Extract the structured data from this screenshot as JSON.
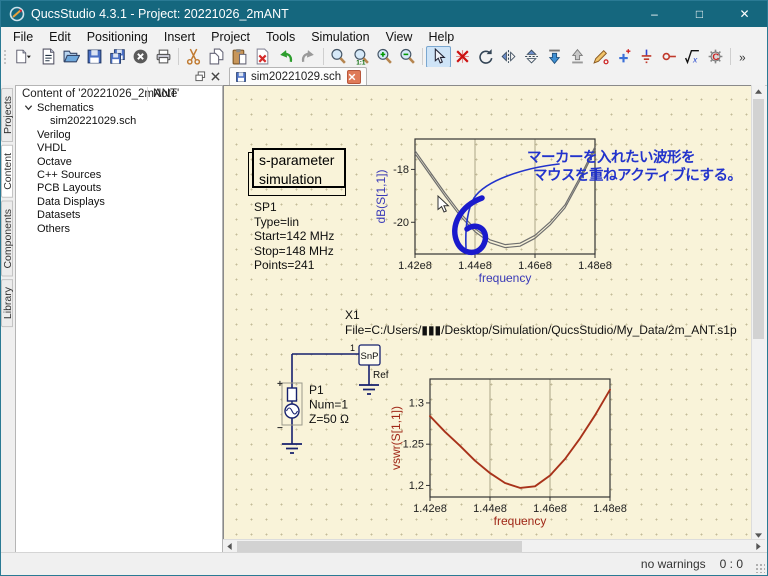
{
  "window": {
    "title": "QucsStudio 4.3.1 - Project: 20221026_2mANT"
  },
  "window_controls": {
    "minimize": "–",
    "maximize": "□",
    "close": "✕"
  },
  "menu": {
    "items": [
      "File",
      "Edit",
      "Positioning",
      "Insert",
      "Project",
      "Tools",
      "Simulation",
      "View",
      "Help"
    ]
  },
  "toolbar": {
    "groups": [
      [
        "new-file",
        "new-text",
        "open",
        "save",
        "save-all",
        "close-document",
        "print"
      ],
      [
        "cut",
        "copy",
        "paste",
        "delete",
        "undo",
        "redo"
      ],
      [
        "zoom-fit",
        "zoom-1-1",
        "zoom-in",
        "zoom-out"
      ],
      [
        "select",
        "deactivate",
        "rotate-ccw",
        "mirror-y",
        "mirror-x",
        "push-into",
        "pop-out",
        "wire-label",
        "insert-pin",
        "ground",
        "port",
        "equation",
        "simulation-settings"
      ],
      [
        "more"
      ]
    ],
    "active_button": "select"
  },
  "document_tab": {
    "label": "sim20221029.sch"
  },
  "sidebar": {
    "tabs": [
      "Projects",
      "Content",
      "Components",
      "Library"
    ],
    "active_tab": "Content",
    "content_header": "Content of '20221026_2mANT'",
    "note_header": "Note",
    "tree": [
      {
        "label": "Schematics",
        "level": 1,
        "chevron": true
      },
      {
        "label": "sim20221029.sch",
        "level": 2
      },
      {
        "label": "Verilog",
        "level": 1
      },
      {
        "label": "VHDL",
        "level": 1
      },
      {
        "label": "Octave",
        "level": 1
      },
      {
        "label": "C++ Sources",
        "level": 1
      },
      {
        "label": "PCB Layouts",
        "level": 1
      },
      {
        "label": "Data Displays",
        "level": 1
      },
      {
        "label": "Datasets",
        "level": 1
      },
      {
        "label": "Others",
        "level": 1
      }
    ]
  },
  "schematic": {
    "sim_block": {
      "line1": "s-parameter",
      "line2": "simulation"
    },
    "sp1": {
      "name": "SP1",
      "type": "Type=lin",
      "start": "Start=142 MHz",
      "stop": "Stop=148 MHz",
      "points": "Points=241"
    },
    "x1": {
      "name": "X1",
      "file": "File=C:/Users/▮▮▮/Desktop/Simulation/QucsStudio/My_Data/2m_ANT.s1p"
    },
    "snp": {
      "label": "SnP",
      "pin": "1",
      "ref": "Ref"
    },
    "p1": {
      "name": "P1",
      "num": "Num=1",
      "z": "Z=50 Ω",
      "plus": "+",
      "minus": "−"
    },
    "annotation": {
      "line1": "マーカーを入れたい波形を",
      "line2": "マウスを重ねアクティブにする。",
      "color": "#2233cc"
    }
  },
  "chart_data": [
    {
      "type": "line",
      "title": "",
      "ylabel": "dB(S[1,1])",
      "xlabel": "frequency",
      "x_unit": "Hz",
      "x_ticks": [
        "1.42e8",
        "1.44e8",
        "1.46e8",
        "1.48e8"
      ],
      "x_tick_values_mhz": [
        142,
        144,
        146,
        148
      ],
      "y_ticks": [
        "-18",
        "-20"
      ],
      "y_tick_values": [
        -18,
        -20
      ],
      "xlim_mhz": [
        142,
        148
      ],
      "ylim": [
        -21.2,
        -16.85
      ],
      "grid_x_mhz": [
        144,
        146
      ],
      "label_color": "#3a3ab8",
      "tick_color": "#222222",
      "series": [
        {
          "name": "dB(S[1,1])",
          "color": "#6e6e6e",
          "style": "double",
          "x_mhz": [
            142,
            142.5,
            143,
            143.5,
            144,
            144.5,
            145,
            145.5,
            146,
            146.5,
            147,
            147.5,
            148
          ],
          "y": [
            -17.35,
            -18.15,
            -18.95,
            -19.7,
            -20.3,
            -20.72,
            -20.9,
            -20.85,
            -20.55,
            -20.05,
            -19.4,
            -18.35,
            -17.2
          ]
        }
      ]
    },
    {
      "type": "line",
      "title": "",
      "ylabel": "vswr(S[1,1])",
      "xlabel": "frequency",
      "x_unit": "Hz",
      "x_ticks": [
        "1.42e8",
        "1.44e8",
        "1.46e8",
        "1.48e8"
      ],
      "x_tick_values_mhz": [
        142,
        144,
        146,
        148
      ],
      "y_ticks": [
        "1.3",
        "1.25",
        "1.2"
      ],
      "y_tick_values": [
        1.3,
        1.25,
        1.2
      ],
      "xlim_mhz": [
        142,
        148
      ],
      "ylim": [
        1.186,
        1.329
      ],
      "grid_x_mhz": [
        144,
        146
      ],
      "label_color": "#a02818",
      "tick_color": "#222222",
      "series": [
        {
          "name": "vswr(S[1,1])",
          "color": "#a8321a",
          "style": "single",
          "x_mhz": [
            142,
            142.5,
            143,
            143.5,
            144,
            144.5,
            145,
            145.5,
            146,
            146.5,
            147,
            147.5,
            148
          ],
          "y": [
            1.284,
            1.265,
            1.248,
            1.23,
            1.215,
            1.203,
            1.197,
            1.199,
            1.212,
            1.232,
            1.257,
            1.285,
            1.316
          ]
        }
      ]
    }
  ],
  "status_bar": {
    "warnings_label": "no warnings",
    "cursor_position": "0 : 0"
  },
  "colors": {
    "titlebar": "#15677e",
    "canvas_bg": "#f9f3d9",
    "grid_dot": "#c4bb98",
    "wire": "#16216e",
    "annotation_blue": "#2233cc",
    "vswr_red": "#a8321a",
    "db_gray": "#6e6e6e"
  }
}
